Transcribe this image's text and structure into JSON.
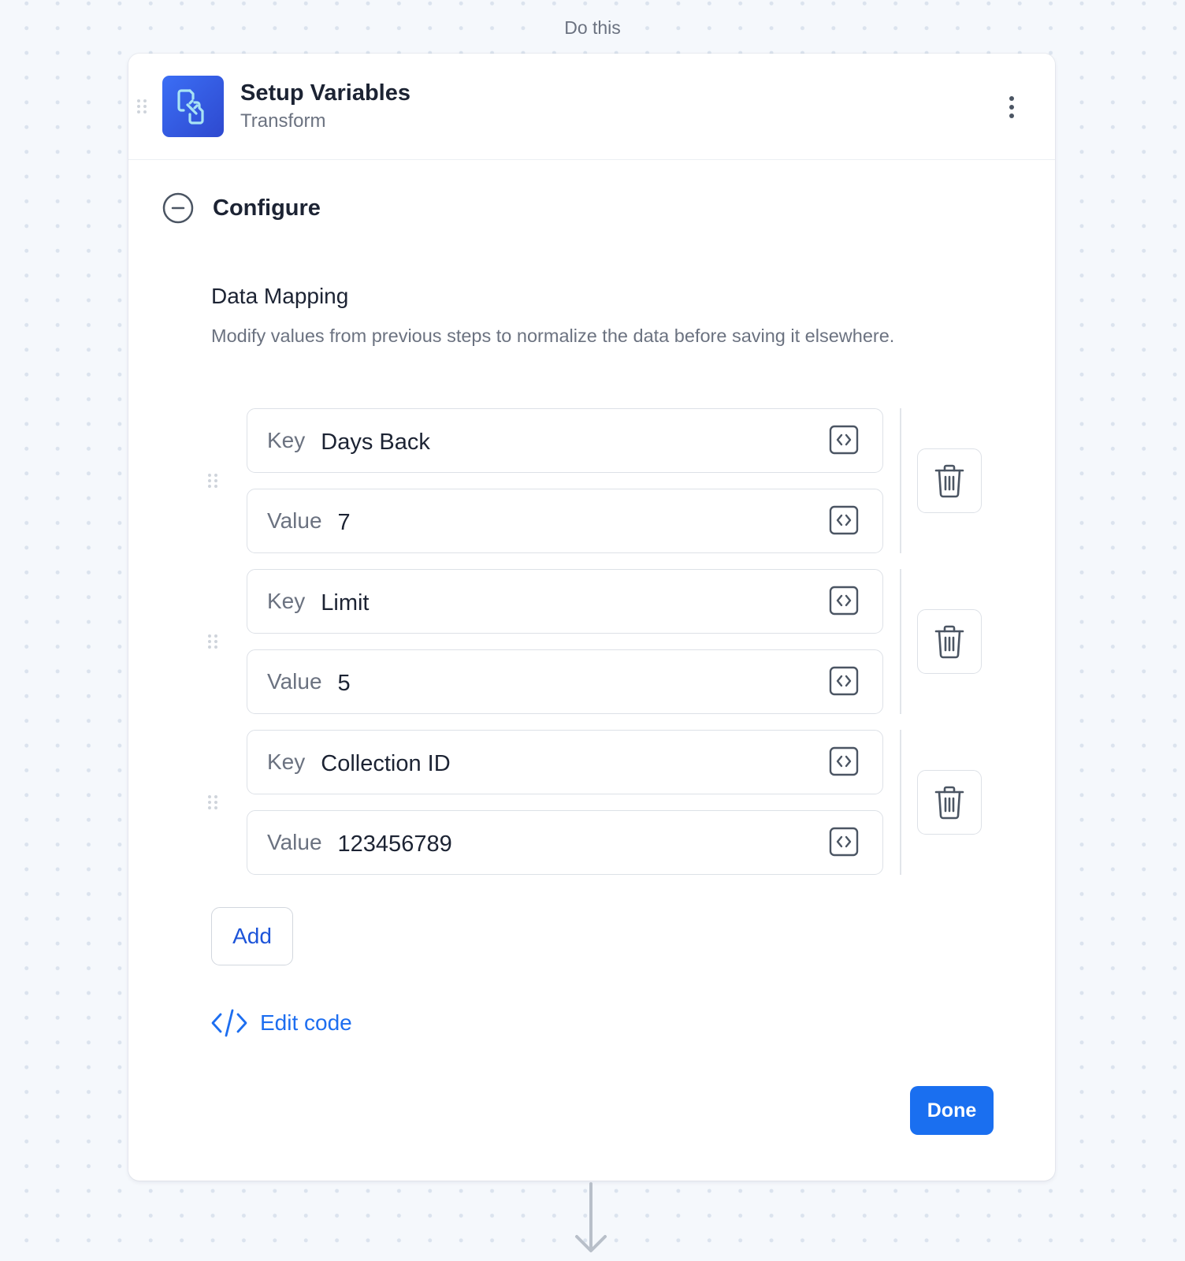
{
  "flow": {
    "label": "Do this"
  },
  "step": {
    "app_name": "Setup Variables",
    "app_type": "Transform",
    "app_icon": "transform-icon",
    "menu_icon": "more-vertical-icon"
  },
  "configure": {
    "title": "Configure",
    "collapse_icon": "minus-circle-icon"
  },
  "data_mapping": {
    "title": "Data Mapping",
    "description": "Modify values from previous steps to normalize the data before saving it elsewhere.",
    "key_label": "Key",
    "value_label": "Value",
    "pairs": [
      {
        "key": "Days Back",
        "value": "7"
      },
      {
        "key": "Limit",
        "value": "5"
      },
      {
        "key": "Collection ID",
        "value": "123456789"
      }
    ]
  },
  "actions": {
    "add_label": "Add",
    "edit_code_label": "Edit code",
    "done_label": "Done"
  },
  "colors": {
    "primary": "#1a6ff0",
    "link": "#1d54d9",
    "icon_gradient_start": "#3b6ef5",
    "icon_gradient_end": "#2e49cf"
  }
}
